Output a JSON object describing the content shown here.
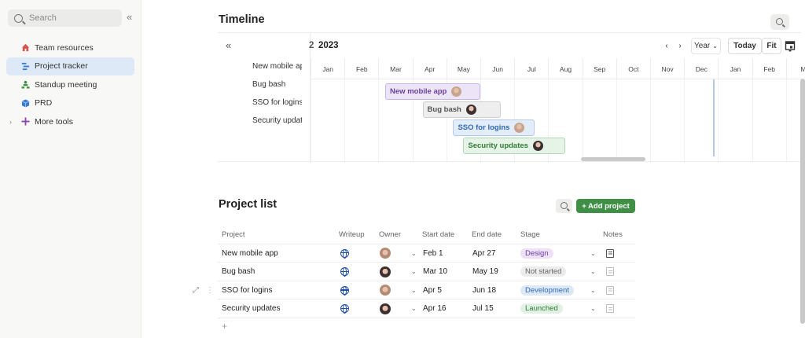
{
  "sidebar": {
    "search_placeholder": "Search",
    "items": [
      {
        "label": "Team resources",
        "icon": "house-icon",
        "color": "#d9534f"
      },
      {
        "label": "Project tracker",
        "icon": "list-icon",
        "color": "#3a7bd5",
        "active": true
      },
      {
        "label": "Standup meeting",
        "icon": "people-icon",
        "color": "#3f8f47"
      },
      {
        "label": "PRD",
        "icon": "cube-icon",
        "color": "#3a7bd5"
      },
      {
        "label": "More tools",
        "icon": "plus-icon",
        "color": "#8e44ad"
      }
    ]
  },
  "timeline": {
    "title": "Timeline",
    "year_prefix": "2",
    "year": "2023",
    "scale": "Year",
    "today_label": "Today",
    "fit_label": "Fit",
    "projects": [
      "New mobile app",
      "Bug bash",
      "SSO for logins",
      "Security updates"
    ],
    "months": [
      "Jan",
      "Feb",
      "Mar",
      "Apr",
      "May",
      "Jun",
      "Jul",
      "Aug",
      "Sep",
      "Oct",
      "Nov",
      "Dec",
      "Jan",
      "Feb",
      "M"
    ],
    "bars": [
      {
        "label": "New mobile app",
        "bg": "#ece4f7",
        "border": "#c9b3ea",
        "color": "#6b3fa0",
        "start_month": 2.2,
        "end_month": 5.0
      },
      {
        "label": "Bug bash",
        "bg": "#eeeeee",
        "border": "#cfcfcf",
        "color": "#555555",
        "start_month": 3.3,
        "end_month": 5.6
      },
      {
        "label": "SSO for logins",
        "bg": "#e3edf9",
        "border": "#b3cbe9",
        "color": "#2f68b5",
        "start_month": 4.2,
        "end_month": 6.6
      },
      {
        "label": "Security updates",
        "bg": "#e6f3e7",
        "border": "#b3d8b6",
        "color": "#2f7d36",
        "start_month": 4.5,
        "end_month": 7.5
      }
    ]
  },
  "project_list": {
    "title": "Project list",
    "add_label": "+ Add project",
    "columns": [
      "Project",
      "Writeup",
      "Owner",
      "Start date",
      "End date",
      "Stage",
      "Notes"
    ],
    "rows": [
      {
        "project": "New mobile app",
        "start": "Feb 1",
        "end": "Apr 27",
        "stage": "Design",
        "stage_bg": "#ede0f7",
        "stage_color": "#6b3fa0",
        "has_notes": true
      },
      {
        "project": "Bug bash",
        "start": "Mar 10",
        "end": "May 19",
        "stage": "Not started",
        "stage_bg": "#ececec",
        "stage_color": "#666666",
        "has_notes": false
      },
      {
        "project": "SSO for logins",
        "start": "Apr 5",
        "end": "Jun 18",
        "stage": "Development",
        "stage_bg": "#dde9f7",
        "stage_color": "#2f68b5",
        "has_notes": false
      },
      {
        "project": "Security updates",
        "start": "Apr 16",
        "end": "Jul 15",
        "stage": "Launched",
        "stage_bg": "#e1f1e3",
        "stage_color": "#2f7d36",
        "has_notes": false
      }
    ]
  }
}
